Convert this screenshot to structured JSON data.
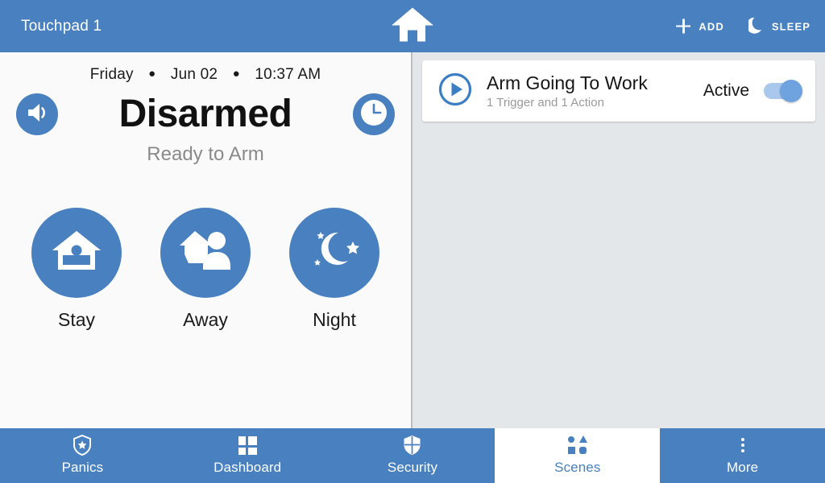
{
  "header": {
    "title": "Touchpad 1",
    "home_icon": "home-icon",
    "add_label": "ADD",
    "add_icon": "plus-icon",
    "sleep_label": "SLEEP",
    "sleep_icon": "moon-icon"
  },
  "security": {
    "date": {
      "weekday": "Friday",
      "separator": "●",
      "date": "Jun 02",
      "time": "10:37 AM"
    },
    "volume_icon": "speaker-icon",
    "history_icon": "clock-icon",
    "status": "Disarmed",
    "substatus": "Ready to Arm",
    "arm_modes": [
      {
        "label": "Stay",
        "icon": "house-person-icon"
      },
      {
        "label": "Away",
        "icon": "house-walking-person-icon"
      },
      {
        "label": "Night",
        "icon": "moon-stars-icon"
      }
    ]
  },
  "scenes": {
    "cards": [
      {
        "play_icon": "play-circle-icon",
        "title": "Arm Going To Work",
        "subtitle": "1 Trigger and 1 Action",
        "state_label": "Active",
        "toggle_on": true
      }
    ]
  },
  "bottom_nav": {
    "items": [
      {
        "label": "Panics",
        "icon": "shield-star-icon",
        "active": false
      },
      {
        "label": "Dashboard",
        "icon": "grid-icon",
        "active": false
      },
      {
        "label": "Security",
        "icon": "shield-icon",
        "active": false
      },
      {
        "label": "Scenes",
        "icon": "shapes-icon",
        "active": true
      },
      {
        "label": "More",
        "icon": "more-vertical-icon",
        "active": false
      }
    ]
  },
  "colors": {
    "brand_blue": "#4880c0",
    "panel_bg": "#fafafa",
    "right_bg": "#e4e7ea",
    "card_bg": "#ffffff",
    "muted_text": "#8a8a8a",
    "toggle_track": "#a9c8ec",
    "toggle_knob": "#6fa3e0"
  }
}
